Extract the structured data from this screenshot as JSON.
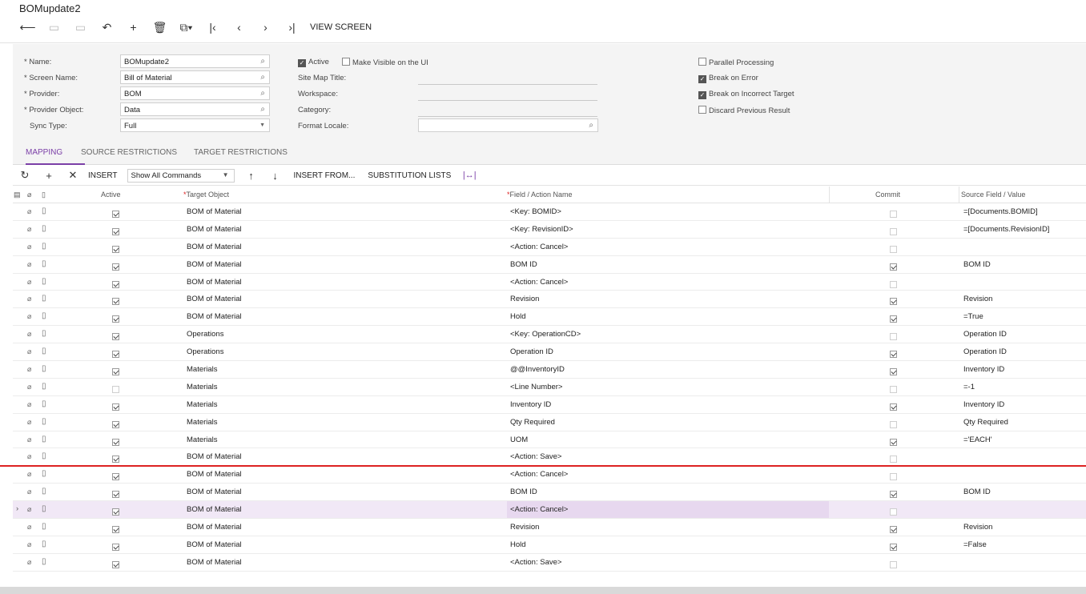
{
  "title": "BOMupdate2",
  "toolbar": {
    "view_screen": "VIEW SCREEN"
  },
  "form": {
    "name_label": "* Name:",
    "name_value": "BOMupdate2",
    "screen_name_label": "* Screen Name:",
    "screen_name_value": "Bill of Material",
    "provider_label": "* Provider:",
    "provider_value": "BOM",
    "provider_object_label": "* Provider Object:",
    "provider_object_value": "Data",
    "sync_type_label": "Sync Type:",
    "sync_type_value": "Full",
    "active_label": "Active",
    "make_visible_label": "Make Visible on the UI",
    "site_map_title_label": "Site Map Title:",
    "workspace_label": "Workspace:",
    "category_label": "Category:",
    "format_locale_label": "Format Locale:",
    "parallel_processing_label": "Parallel Processing",
    "break_on_error_label": "Break on Error",
    "break_on_incorrect_label": "Break on Incorrect Target",
    "discard_previous_label": "Discard Previous Result"
  },
  "tabs": [
    "MAPPING",
    "SOURCE RESTRICTIONS",
    "TARGET RESTRICTIONS"
  ],
  "gridbar": {
    "insert": "INSERT",
    "filter_value": "Show All Commands",
    "insert_from": "INSERT FROM...",
    "substitution_lists": "SUBSTITUTION LISTS"
  },
  "columns": {
    "active": "Active",
    "target_object": "Target Object",
    "field_action": "Field / Action Name",
    "commit": "Commit",
    "source_field": "Source Field / Value"
  },
  "rows": [
    {
      "active": true,
      "target": "BOM of Material",
      "field": "<Key: BOMID>",
      "commit": false,
      "source": "=[Documents.BOMID]"
    },
    {
      "active": true,
      "target": "BOM of Material",
      "field": "<Key: RevisionID>",
      "commit": false,
      "source": "=[Documents.RevisionID]"
    },
    {
      "active": true,
      "target": "BOM of Material",
      "field": "<Action: Cancel>",
      "commit": false,
      "source": ""
    },
    {
      "active": true,
      "target": "BOM of Material",
      "field": "BOM ID",
      "commit": true,
      "source": "BOM ID"
    },
    {
      "active": true,
      "target": "BOM of Material",
      "field": "<Action: Cancel>",
      "commit": false,
      "source": ""
    },
    {
      "active": true,
      "target": "BOM of Material",
      "field": "Revision",
      "commit": true,
      "source": "Revision"
    },
    {
      "active": true,
      "target": "BOM of Material",
      "field": "Hold",
      "commit": true,
      "source": "=True"
    },
    {
      "active": true,
      "target": "Operations",
      "field": "<Key: OperationCD>",
      "commit": false,
      "source": "Operation ID"
    },
    {
      "active": true,
      "target": "Operations",
      "field": "Operation ID",
      "commit": true,
      "source": "Operation ID"
    },
    {
      "active": true,
      "target": "Materials",
      "field": "@@InventoryID",
      "commit": true,
      "source": "Inventory ID"
    },
    {
      "active": false,
      "target": "Materials",
      "field": "<Line Number>",
      "commit": false,
      "source": "=-1"
    },
    {
      "active": true,
      "target": "Materials",
      "field": "Inventory ID",
      "commit": true,
      "source": "Inventory ID"
    },
    {
      "active": true,
      "target": "Materials",
      "field": "Qty Required",
      "commit": false,
      "source": "Qty Required"
    },
    {
      "active": true,
      "target": "Materials",
      "field": "UOM",
      "commit": true,
      "source": "='EACH'"
    },
    {
      "active": true,
      "target": "BOM of Material",
      "field": "<Action: Save>",
      "commit": false,
      "source": ""
    },
    {
      "active": true,
      "target": "BOM of Material",
      "field": "<Action: Cancel>",
      "commit": false,
      "source": ""
    },
    {
      "active": true,
      "target": "BOM of Material",
      "field": "BOM ID",
      "commit": true,
      "source": "BOM ID"
    },
    {
      "active": true,
      "target": "BOM of Material",
      "field": "<Action: Cancel>",
      "commit": false,
      "source": "",
      "selected": true
    },
    {
      "active": true,
      "target": "BOM of Material",
      "field": "Revision",
      "commit": true,
      "source": "Revision"
    },
    {
      "active": true,
      "target": "BOM of Material",
      "field": "Hold",
      "commit": true,
      "source": "=False"
    },
    {
      "active": true,
      "target": "BOM of Material",
      "field": "<Action: Save>",
      "commit": false,
      "source": ""
    }
  ]
}
